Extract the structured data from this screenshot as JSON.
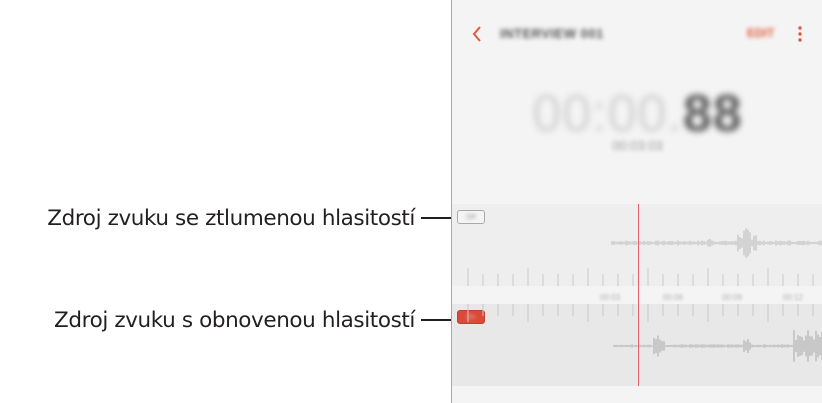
{
  "callouts": {
    "muted_source": "Zdroj zvuku se ztlumenou hlasitostí",
    "restored_source": "Zdroj zvuku s obnovenou hlasitostí"
  },
  "phone": {
    "title": "INTERVIEW 001",
    "edit": "EDIT",
    "timer_dim": "00:00.",
    "timer_bold": "88",
    "subtime": "00:03:03",
    "tracks": [
      {
        "label": "Off",
        "color": "#eeeeee"
      },
      {
        "label": "On",
        "color": "#d94a38"
      }
    ],
    "ruler_labels": [
      "00:03",
      "00:06",
      "00:09",
      "00:12"
    ],
    "accent": "#e05a3c",
    "playhead_color": "#e6606d"
  }
}
